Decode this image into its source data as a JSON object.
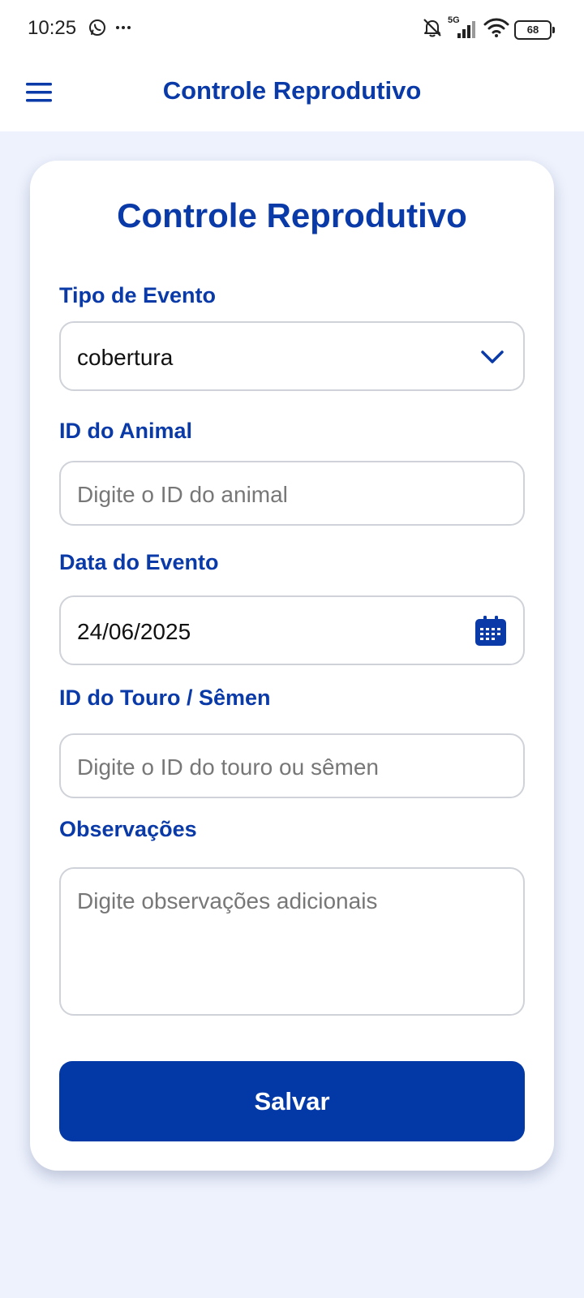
{
  "status_bar": {
    "time": "10:25",
    "network": "5G",
    "battery": "68",
    "icons": [
      "whatsapp-icon",
      "more-icon",
      "mute-icon",
      "signal-icon",
      "wifi-icon",
      "battery-icon"
    ]
  },
  "header": {
    "title": "Controle Reprodutivo",
    "menu_icon": "hamburger-menu-icon"
  },
  "form": {
    "title": "Controle Reprodutivo",
    "event_type": {
      "label": "Tipo de Evento",
      "value": "cobertura",
      "icon": "chevron-down-icon"
    },
    "animal_id": {
      "label": "ID do Animal",
      "placeholder": "Digite o ID do animal"
    },
    "event_date": {
      "label": "Data do Evento",
      "value": "24/06/2025",
      "icon": "calendar-icon"
    },
    "bull_id": {
      "label": "ID do Touro / Sêmen",
      "placeholder": "Digite o ID do touro ou sêmen"
    },
    "notes": {
      "label": "Observações",
      "placeholder": "Digite observações adicionais"
    },
    "save_label": "Salvar"
  },
  "colors": {
    "primary": "#0339a6",
    "title": "#0a3aa8",
    "background": "#eef2fd",
    "card": "#ffffff",
    "border": "#cfd2d8",
    "placeholder": "#777777"
  }
}
